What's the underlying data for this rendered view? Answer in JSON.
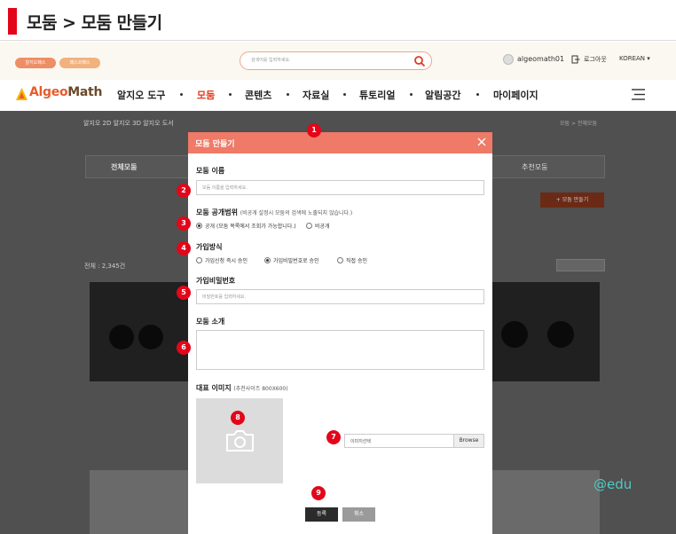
{
  "guide": {
    "title": "모둠 > 모둠 만들기"
  },
  "header": {
    "pill1": "알지오패스",
    "pill2": "패스코패스",
    "search_placeholder": "검색어를 입력하세요.",
    "user": "algeomath01",
    "logout": "로그아웃",
    "language": "KOREAN"
  },
  "nav": {
    "logo_a": "Algeo",
    "logo_b": "Math",
    "items": [
      "알지오 도구",
      "모둠",
      "콘텐츠",
      "자료실",
      "튜토리얼",
      "알림공간",
      "마이페이지"
    ]
  },
  "background": {
    "breadcrumb_left": "알지오 2D   알지오 3D   알지오 도서",
    "breadcrumb_right": "모둠  >  전체모둠",
    "tab_all": "전체모둠",
    "tab_recommended": "추천모둠",
    "new_group": "+ 모둠 만들기",
    "total_label": "전체 : 2,345건",
    "watermark": "@edu"
  },
  "modal": {
    "title": "모둠 만들기",
    "name_label": "모둠 이름",
    "name_placeholder": "모둠 이름을 입력하세요.",
    "scope_label": "모둠 공개범위",
    "scope_note": "(비공개 설정시 모둠의 검색에 노출되지 않습니다.)",
    "scope_public": "공개 (모둠 목록에서 조회가 가능합니다.)",
    "scope_private": "비공개",
    "join_label": "가입방식",
    "join_instant": "가입신청 즉시 승인",
    "join_password": "가입비밀번호로 승인",
    "join_direct": "직접 승인",
    "password_label": "가입비밀번호",
    "password_placeholder": "비밀번호를 입력하세요.",
    "intro_label": "모둠 소개",
    "image_label": "대표 이미지",
    "image_note": "(추천사이즈 800X600)",
    "file_value": "이미지선택",
    "browse": "Browse",
    "register": "등록",
    "cancel": "취소"
  },
  "markers": [
    "1",
    "2",
    "3",
    "4",
    "5",
    "6",
    "7",
    "8",
    "9"
  ],
  "colors": {
    "accent": "#e3061a",
    "modal_header": "#ee7a67",
    "brand": "#e85b2c"
  }
}
